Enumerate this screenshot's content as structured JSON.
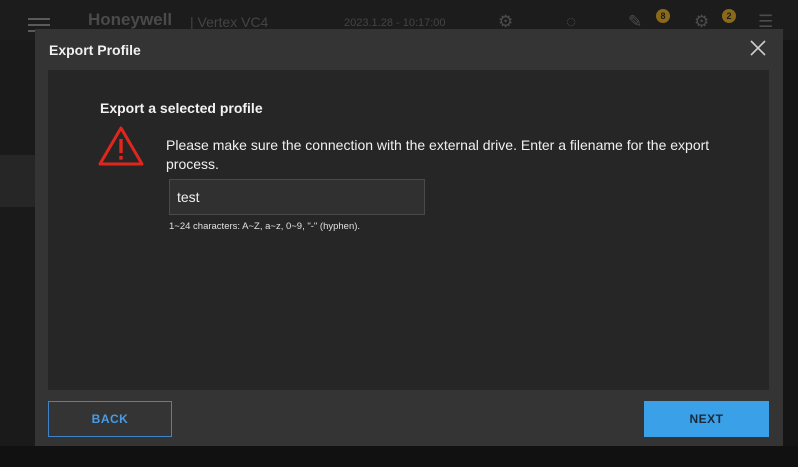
{
  "app": {
    "brand": "Honeywell",
    "product": "| Vertex VC4",
    "datetime": "2023.1.28 - 10:17:00",
    "badges": [
      "8",
      "2"
    ]
  },
  "dialog": {
    "title": "Export Profile",
    "section_title": "Export a selected profile",
    "message": "Please make sure the connection with the external drive. Enter a filename for the export process.",
    "filename": {
      "value": "test",
      "placeholder": ""
    },
    "hint": "1~24 characters: A~Z, a~z, 0~9, \"-\" (hyphen).",
    "back_label": "BACK",
    "next_label": "NEXT"
  },
  "icons": {
    "close": "close-icon",
    "warning": "warning-icon"
  },
  "colors": {
    "warning": "#e0261d",
    "accent": "#3aa0e8",
    "modal_bg": "#343434",
    "body_bg": "#262626"
  }
}
